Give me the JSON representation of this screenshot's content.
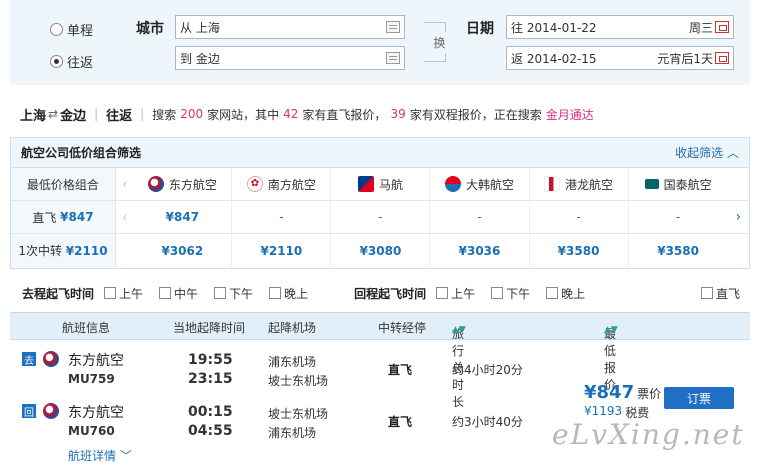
{
  "search": {
    "trip_options": [
      {
        "label": "单程",
        "selected": false
      },
      {
        "label": "往返",
        "selected": true
      }
    ],
    "city_label": "城市",
    "from_value": "从 上海",
    "to_value": "到 金边",
    "swap_label": "换",
    "date_label": "日期",
    "depart_date": "往 2014-01-22",
    "depart_tag": "周三",
    "return_date": "返 2014-02-15",
    "return_tag": "元宵后1天"
  },
  "summary": {
    "route_from": "上海",
    "route_arrow": "⇄",
    "route_to": "金边",
    "trip_type": "往返",
    "text1": "搜索",
    "num1": "200",
    "text2": "家网站，其中",
    "num2": "42",
    "text3": "家有直飞报价，",
    "num3": "39",
    "text4": "家有双程报价，正在搜索",
    "searching": "金月通达"
  },
  "airline_filter": {
    "title": "航空公司低价组合筛选",
    "collapse_label": "收起筛选",
    "header_label": "最低价格组合",
    "airlines": [
      {
        "name": "东方航空",
        "color": "#c8102e"
      },
      {
        "name": "南方航空",
        "color": "#d6001c"
      },
      {
        "name": "马航",
        "color": "#003a8c"
      },
      {
        "name": "大韩航空",
        "color": "#1d70b7"
      },
      {
        "name": "港龙航空",
        "color": "#c8102e"
      },
      {
        "name": "国泰航空",
        "color": "#006564"
      }
    ],
    "rows": [
      {
        "label": "直飞",
        "price": "¥847",
        "cells": [
          "¥847",
          "-",
          "-",
          "-",
          "-",
          "-"
        ]
      },
      {
        "label": "1次中转",
        "price": "¥2110",
        "cells": [
          "¥3062",
          "¥2110",
          "¥3080",
          "¥3036",
          "¥3580",
          "¥3580"
        ]
      }
    ]
  },
  "time_filter": {
    "outbound_label": "去程起飞时间",
    "outbound_options": [
      "上午",
      "中午",
      "下午",
      "晚上"
    ],
    "return_label": "回程起飞时间",
    "return_options": [
      "上午",
      "下午",
      "晚上"
    ],
    "direct_label": "直飞"
  },
  "results_header": {
    "flight_info": "航班信息",
    "local_time": "当地起降时间",
    "airport": "起降机场",
    "transfer": "中转经停",
    "duration": "旅行总时长",
    "price": "最低报价"
  },
  "result": {
    "legs": [
      {
        "badge": "去",
        "airline": "东方航空",
        "flight_no": "MU759",
        "depart_time": "19:55",
        "arrive_time": "23:15",
        "depart_airport": "浦东机场",
        "arrive_airport": "坡士东机场",
        "transfer": "直飞",
        "duration": "约4小时20分"
      },
      {
        "badge": "回",
        "airline": "东方航空",
        "flight_no": "MU760",
        "depart_time": "00:15",
        "arrive_time": "04:55",
        "depart_airport": "坡士东机场",
        "arrive_airport": "浦东机场",
        "transfer": "直飞",
        "duration": "约3小时40分"
      }
    ],
    "price": "¥847",
    "price_suffix": "票价",
    "tax": "¥1193",
    "tax_suffix": "税费",
    "book_label": "订票",
    "detail_label": "航班详情"
  },
  "watermark": "eLvXing.net"
}
